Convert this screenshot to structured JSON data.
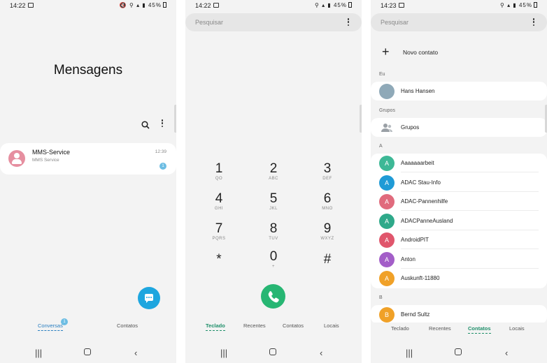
{
  "screens": {
    "messages": {
      "status": {
        "time": "14:22",
        "icons": "🔇 ⚲ ▴ ▮",
        "battery": "45%"
      },
      "title": "Mensagens",
      "conversation": {
        "name": "MMS-Service",
        "preview": "MMS Service",
        "time": "12:39",
        "unread": "1"
      },
      "tabs": [
        {
          "label": "Conversas",
          "badge": "1"
        },
        {
          "label": "Contatos"
        }
      ],
      "icons": {
        "search": "search-icon",
        "more": "more-vert-icon",
        "compose": "chat-compose-icon"
      }
    },
    "dialer": {
      "status": {
        "time": "14:22",
        "icons": "⚲ ▴ ▮",
        "battery": "45%"
      },
      "search_placeholder": "Pesquisar",
      "keys": [
        {
          "digit": "1",
          "letters": "QO"
        },
        {
          "digit": "2",
          "letters": "ABC"
        },
        {
          "digit": "3",
          "letters": "DEF"
        },
        {
          "digit": "4",
          "letters": "GHI"
        },
        {
          "digit": "5",
          "letters": "JKL"
        },
        {
          "digit": "6",
          "letters": "MNO"
        },
        {
          "digit": "7",
          "letters": "PQRS"
        },
        {
          "digit": "8",
          "letters": "TUV"
        },
        {
          "digit": "9",
          "letters": "WXYZ"
        },
        {
          "digit": "*",
          "letters": ""
        },
        {
          "digit": "0",
          "letters": "+"
        },
        {
          "digit": "#",
          "letters": ""
        }
      ],
      "tabs": [
        {
          "label": "Teclado"
        },
        {
          "label": "Recentes"
        },
        {
          "label": "Contatos"
        },
        {
          "label": "Locais"
        }
      ]
    },
    "contacts": {
      "status": {
        "time": "14:23",
        "icons": "⚲ ▴ ▮",
        "battery": "45%"
      },
      "search_placeholder": "Pesquisar",
      "add_contact": "Novo contato",
      "sections": {
        "me": "Eu",
        "groups": "Grupos",
        "a": "A",
        "b": "B"
      },
      "me_name": "Hans Hansen",
      "groups_label": "Grupos",
      "contacts_a": [
        {
          "initial": "A",
          "name": "Aaaaaaarbeit",
          "color": "#3db896"
        },
        {
          "initial": "A",
          "name": "ADAC Stau-Info",
          "color": "#1f9bd6"
        },
        {
          "initial": "A",
          "name": "ADAC-Pannenhilfe",
          "color": "#e06b7d"
        },
        {
          "initial": "A",
          "name": "ADACPanneAusland",
          "color": "#2fa98a"
        },
        {
          "initial": "A",
          "name": "AndroidPIT",
          "color": "#e0566c"
        },
        {
          "initial": "A",
          "name": "Anton",
          "color": "#a35ec8"
        },
        {
          "initial": "A",
          "name": "Auskunft-11880",
          "color": "#f0a128"
        }
      ],
      "contacts_b": [
        {
          "initial": "B",
          "name": "Bernd Sultz",
          "color": "#f0a128"
        }
      ],
      "tabs": [
        {
          "label": "Teclado"
        },
        {
          "label": "Recentes"
        },
        {
          "label": "Contatos"
        },
        {
          "label": "Locais"
        }
      ]
    }
  },
  "colors": {
    "accent_green": "#1f8f6a",
    "accent_blue": "#1ea6df",
    "call_green": "#27b673",
    "badge": "#6dbde3"
  }
}
